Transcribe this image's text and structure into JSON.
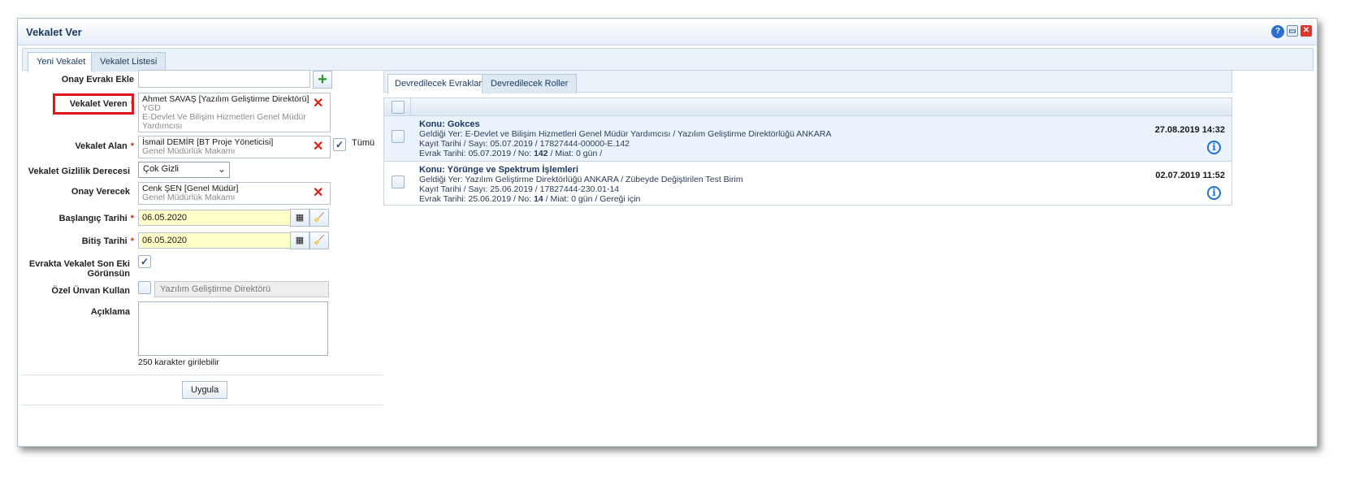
{
  "window": {
    "title": "Vekalet Ver"
  },
  "tabs": [
    {
      "label": "Yeni Vekalet"
    },
    {
      "label": "Vekalet Listesi"
    }
  ],
  "form": {
    "onay_evraki": {
      "label": "Onay Evrakı Ekle",
      "value": ""
    },
    "vekalet_veren": {
      "label": "Vekalet Veren",
      "person": "Ahmet SAVAŞ [Yazılım Geliştirme Direktörü]",
      "line2": "YGD",
      "line3": "E-Devlet Ve Bilişim Hizmetleri Genel Müdür",
      "line4": "Yardımcısı"
    },
    "vekalet_alan": {
      "label": "Vekalet Alan",
      "person": "İsmail DEMİR [BT Proje Yöneticisi]",
      "line2": "Genel Müdürlük Makamı",
      "tumu_label": "Tümü"
    },
    "gizlilik": {
      "label": "Vekalet Gizlilik Derecesi",
      "value": "Çok Gizli"
    },
    "onay_verecek": {
      "label": "Onay Verecek",
      "person": "Cenk ŞEN [Genel Müdür]",
      "line2": "Genel Müdürlük Makamı"
    },
    "baslangic": {
      "label": "Başlangıç Tarihi",
      "value": "06.05.2020"
    },
    "bitis": {
      "label": "Bitiş Tarihi",
      "value": "06.05.2020"
    },
    "son_ek": {
      "label_line1": "Evrakta Vekalet Son Eki",
      "label_line2": "Görünsün",
      "checked": true
    },
    "ozel_unvan": {
      "label": "Özel Ünvan Kullan",
      "value": "Yazılım Geliştirme Direktörü",
      "checked": false
    },
    "aciklama": {
      "label": "Açıklama",
      "value": "",
      "hint": "250 karakter girilebilir"
    },
    "apply_label": "Uygula"
  },
  "right_tabs": [
    {
      "label": "Devredilecek Evraklar"
    },
    {
      "label": "Devredilecek Roller"
    }
  ],
  "documents": [
    {
      "subject": "Konu: Gokces",
      "line1": "Geldiği Yer: E-Devlet ve Bilişim Hizmetleri Genel Müdür Yardımcısı / Yazılım Geliştirme Direktörlüğü ANKARA",
      "line2": "Kayıt Tarihi / Sayı: 05.07.2019 / 17827444-00000-E.142",
      "line3_pre": "Evrak Tarihi: 05.07.2019 / No: ",
      "line3_no": "142",
      "line3_post": " / Miat: 0 gün /",
      "date": "27.08.2019 14:32"
    },
    {
      "subject": "Konu: Yörünge ve Spektrum İşlemleri",
      "line1": "Geldiği Yer: Yazılım Geliştirme Direktörlüğü ANKARA / Zübeyde Değiştirilen Test Birim",
      "line2": "Kayıt Tarihi / Sayı: 25.06.2019 / 17827444-230.01-14",
      "line3_pre": "Evrak Tarihi: 25.06.2019 / No: ",
      "line3_no": "14",
      "line3_post": " / Miat: 0 gün / Gereği için",
      "date": "02.07.2019 11:52"
    }
  ],
  "colors": {
    "required": "#d0231c",
    "highlight": "#e4141b",
    "date_bg": "#ffffc8",
    "accent": "#1f73c9"
  }
}
